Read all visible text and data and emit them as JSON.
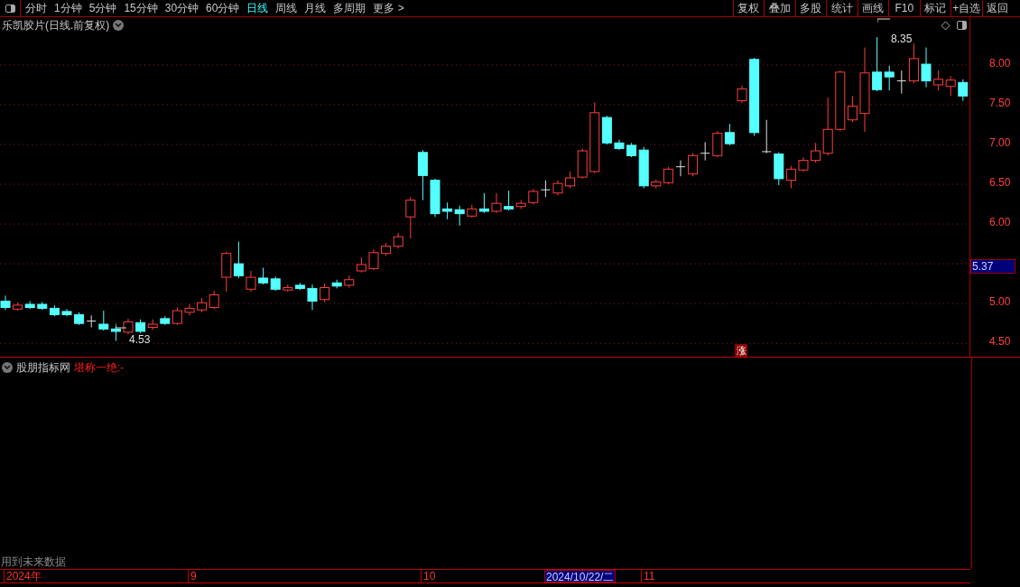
{
  "toolbar": {
    "periods": [
      {
        "label": "分时",
        "selected": false
      },
      {
        "label": "1分钟",
        "selected": false
      },
      {
        "label": "5分钟",
        "selected": false
      },
      {
        "label": "15分钟",
        "selected": false
      },
      {
        "label": "30分钟",
        "selected": false
      },
      {
        "label": "60分钟",
        "selected": false
      },
      {
        "label": "日线",
        "selected": true
      },
      {
        "label": "周线",
        "selected": false
      },
      {
        "label": "月线",
        "selected": false
      },
      {
        "label": "多周期",
        "selected": false
      },
      {
        "label": "更多 >",
        "selected": false
      }
    ],
    "actions": [
      "复权",
      "叠加",
      "多股",
      "统计",
      "画线",
      "F10",
      "标记",
      "+自选",
      "返回"
    ]
  },
  "chart": {
    "title": "乐凯胶片(日线.前复权)",
    "high_label": "8.35",
    "low_label": "4.53",
    "signal_marker": "涨",
    "current_price": "5.37",
    "chart_data": {
      "type": "candlestick",
      "ylim": [
        4.32,
        8.59
      ],
      "grid": true,
      "yticks": [
        {
          "value": 8,
          "label": "8.00"
        },
        {
          "value": 7.5,
          "label": "7.50"
        },
        {
          "value": 7,
          "label": "7.00"
        },
        {
          "value": 6.5,
          "label": "6.50"
        },
        {
          "value": 6,
          "label": "6.00"
        },
        {
          "value": 5,
          "label": "5.00"
        },
        {
          "value": 4.5,
          "label": "4.50"
        }
      ],
      "ohlc": [
        [
          5.03,
          5.1,
          4.92,
          4.95
        ],
        [
          4.93,
          5.01,
          4.91,
          4.98
        ],
        [
          4.99,
          5.03,
          4.93,
          4.95
        ],
        [
          4.99,
          5.02,
          4.92,
          4.94
        ],
        [
          4.94,
          4.98,
          4.84,
          4.86
        ],
        [
          4.9,
          4.93,
          4.84,
          4.86
        ],
        [
          4.86,
          4.89,
          4.73,
          4.75
        ],
        [
          4.78,
          4.85,
          4.7,
          4.78
        ],
        [
          4.74,
          4.91,
          4.66,
          4.68
        ],
        [
          4.68,
          4.72,
          4.53,
          4.65
        ],
        [
          4.64,
          4.81,
          4.61,
          4.77
        ],
        [
          4.76,
          4.8,
          4.63,
          4.65
        ],
        [
          4.7,
          4.8,
          4.67,
          4.74
        ],
        [
          4.81,
          4.84,
          4.73,
          4.75
        ],
        [
          4.75,
          4.95,
          4.73,
          4.91
        ],
        [
          4.89,
          4.99,
          4.85,
          4.94
        ],
        [
          4.92,
          5.07,
          4.89,
          5.01
        ],
        [
          4.95,
          5.16,
          4.93,
          5.11
        ],
        [
          5.33,
          5.65,
          5.15,
          5.63
        ],
        [
          5.5,
          5.78,
          5.32,
          5.35
        ],
        [
          5.18,
          5.41,
          5.15,
          5.33
        ],
        [
          5.32,
          5.45,
          5.24,
          5.26
        ],
        [
          5.31,
          5.34,
          5.16,
          5.18
        ],
        [
          5.17,
          5.24,
          5.15,
          5.2
        ],
        [
          5.23,
          5.26,
          5.17,
          5.19
        ],
        [
          5.19,
          5.24,
          4.92,
          5.03
        ],
        [
          5.05,
          5.25,
          5.02,
          5.2
        ],
        [
          5.26,
          5.3,
          5.19,
          5.22
        ],
        [
          5.23,
          5.35,
          5.2,
          5.3
        ],
        [
          5.41,
          5.58,
          5.39,
          5.49
        ],
        [
          5.44,
          5.68,
          5.42,
          5.64
        ],
        [
          5.63,
          5.76,
          5.6,
          5.72
        ],
        [
          5.72,
          5.89,
          5.69,
          5.84
        ],
        [
          6.09,
          6.34,
          5.82,
          6.3
        ],
        [
          6.9,
          6.93,
          6.3,
          6.61
        ],
        [
          6.55,
          6.57,
          6.09,
          6.13
        ],
        [
          6.19,
          6.27,
          6.06,
          6.16
        ],
        [
          6.18,
          6.23,
          5.98,
          6.13
        ],
        [
          6.1,
          6.24,
          6.08,
          6.19
        ],
        [
          6.19,
          6.39,
          6.14,
          6.16
        ],
        [
          6.16,
          6.39,
          6.14,
          6.26
        ],
        [
          6.22,
          6.42,
          6.17,
          6.19
        ],
        [
          6.22,
          6.3,
          6.19,
          6.26
        ],
        [
          6.27,
          6.44,
          6.25,
          6.41
        ],
        [
          6.43,
          6.55,
          6.34,
          6.43
        ],
        [
          6.39,
          6.55,
          6.36,
          6.51
        ],
        [
          6.48,
          6.66,
          6.45,
          6.58
        ],
        [
          6.59,
          6.95,
          6.57,
          6.92
        ],
        [
          6.66,
          7.53,
          6.64,
          7.4
        ],
        [
          7.34,
          7.36,
          7.0,
          7.02
        ],
        [
          7.02,
          7.06,
          6.93,
          6.95
        ],
        [
          6.99,
          7.02,
          6.84,
          6.86
        ],
        [
          6.93,
          6.97,
          6.45,
          6.48
        ],
        [
          6.48,
          6.56,
          6.45,
          6.53
        ],
        [
          6.52,
          6.72,
          6.5,
          6.69
        ],
        [
          6.72,
          6.8,
          6.6,
          6.72
        ],
        [
          6.63,
          6.89,
          6.6,
          6.86
        ],
        [
          6.89,
          7.03,
          6.8,
          6.89
        ],
        [
          6.86,
          7.17,
          6.84,
          7.14
        ],
        [
          7.15,
          7.26,
          6.99,
          7.01
        ],
        [
          7.55,
          7.74,
          7.52,
          7.7
        ],
        [
          8.07,
          8.09,
          7.11,
          7.15
        ],
        [
          6.91,
          7.31,
          6.89,
          6.91
        ],
        [
          6.88,
          6.9,
          6.49,
          6.57
        ],
        [
          6.55,
          6.73,
          6.45,
          6.69
        ],
        [
          6.68,
          6.84,
          6.66,
          6.8
        ],
        [
          6.8,
          7.02,
          6.77,
          6.92
        ],
        [
          6.89,
          7.59,
          6.86,
          7.19
        ],
        [
          7.19,
          7.93,
          7.17,
          7.91
        ],
        [
          7.31,
          7.61,
          7.28,
          7.48
        ],
        [
          7.39,
          8.22,
          7.16,
          7.9
        ],
        [
          7.91,
          8.35,
          7.67,
          7.69
        ],
        [
          7.91,
          7.99,
          7.68,
          7.85
        ],
        [
          7.8,
          7.93,
          7.64,
          7.8
        ],
        [
          7.8,
          8.27,
          7.77,
          8.08
        ],
        [
          8.01,
          8.22,
          7.72,
          7.8
        ],
        [
          7.75,
          7.93,
          7.68,
          7.82
        ],
        [
          7.73,
          7.86,
          7.61,
          7.81
        ],
        [
          7.78,
          7.82,
          7.55,
          7.61
        ]
      ]
    }
  },
  "indicator": {
    "name": "股朋指标网",
    "formula": "堪称一绝:-",
    "note": "用到未来数据"
  },
  "date_axis": {
    "labels": [
      "2024年",
      "9",
      "10",
      "11"
    ],
    "cursor_date": "2024/10/22/二"
  }
}
